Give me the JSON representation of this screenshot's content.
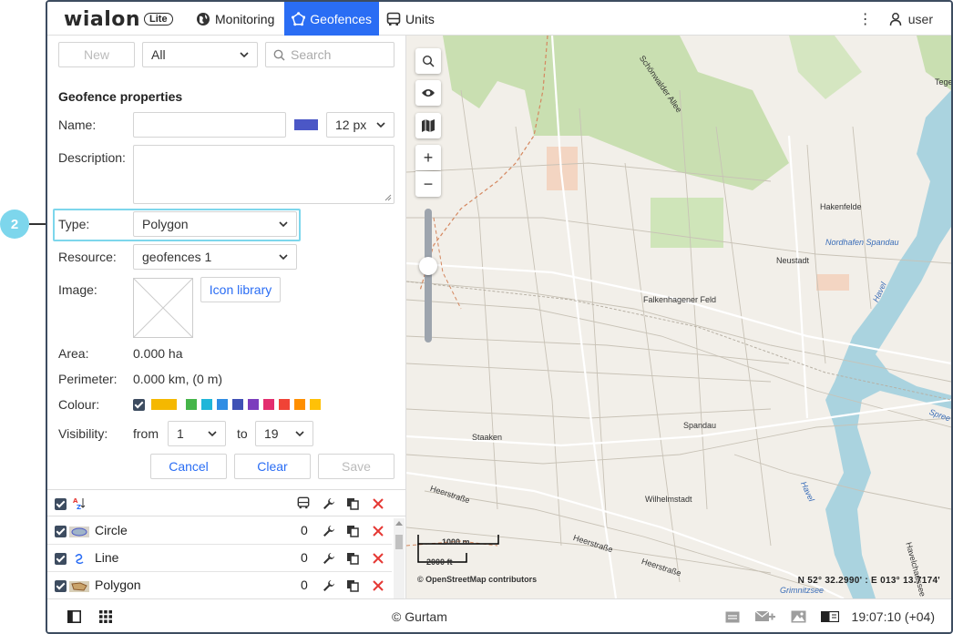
{
  "callout": {
    "number": "2"
  },
  "brand": {
    "name": "wialon",
    "edition": "Lite"
  },
  "nav": {
    "monitoring": "Monitoring",
    "geofences": "Geofences",
    "units": "Units"
  },
  "user": {
    "name": "user"
  },
  "toolbar": {
    "new_label": "New",
    "filter_value": "All",
    "search_placeholder": "Search"
  },
  "form": {
    "title": "Geofence properties",
    "name_label": "Name:",
    "name_value": "",
    "font_size": "12 px",
    "description_label": "Description:",
    "type_label": "Type:",
    "type_value": "Polygon",
    "resource_label": "Resource:",
    "resource_value": "geofences 1",
    "image_label": "Image:",
    "icon_library": "Icon library",
    "area_label": "Area:",
    "area_value": "0.000 ha",
    "perimeter_label": "Perimeter:",
    "perimeter_value": "0.000 km, (0 m)",
    "colour_label": "Colour:",
    "visibility_label": "Visibility:",
    "from_label": "from",
    "from_value": "1",
    "to_label": "to",
    "to_value": "19",
    "cancel": "Cancel",
    "clear": "Clear",
    "save": "Save",
    "selected_colour": "#4b57c6",
    "palette": [
      "#f5b800",
      "#45b549",
      "#1fb6d9",
      "#2f8de4",
      "#3f51b5",
      "#7c3dbd",
      "#e32d6f",
      "#f04336",
      "#ff8f00",
      "#ffc107"
    ]
  },
  "list": {
    "rows": [
      {
        "name": "Circle",
        "count": "0"
      },
      {
        "name": "Line",
        "count": "0"
      },
      {
        "name": "Polygon",
        "count": "0"
      }
    ]
  },
  "footer": {
    "copyright": "© Gurtam",
    "time": "19:07:10 (+04)"
  },
  "map": {
    "labels": {
      "schoenwalder": "Schönwalder Allee",
      "tegel": "Tege",
      "hakenfelde": "Hakenfelde",
      "nordhafen": "Nordhafen Spandau",
      "neustadt": "Neustadt",
      "falkenhagener": "Falkenhagener Feld",
      "havel1": "Havel",
      "spandau": "Spandau",
      "staaken": "Staaken",
      "spree": "Spree",
      "heerstrasse1": "Heerstraße",
      "heerstrasse2": "Heerstraße",
      "heerstrasse3": "Heerstraße",
      "wilhelmstadt": "Wilhelmstadt",
      "havel2": "Havel",
      "havelchaussee": "Havelchaussee",
      "grimnitzsee": "Grimnitzsee"
    },
    "scale_m": "1000 m",
    "scale_ft": "2000 ft",
    "attribution": "© OpenStreetMap contributors",
    "coordinates": "N 52° 32.2990' : E 013° 13.7174'"
  }
}
